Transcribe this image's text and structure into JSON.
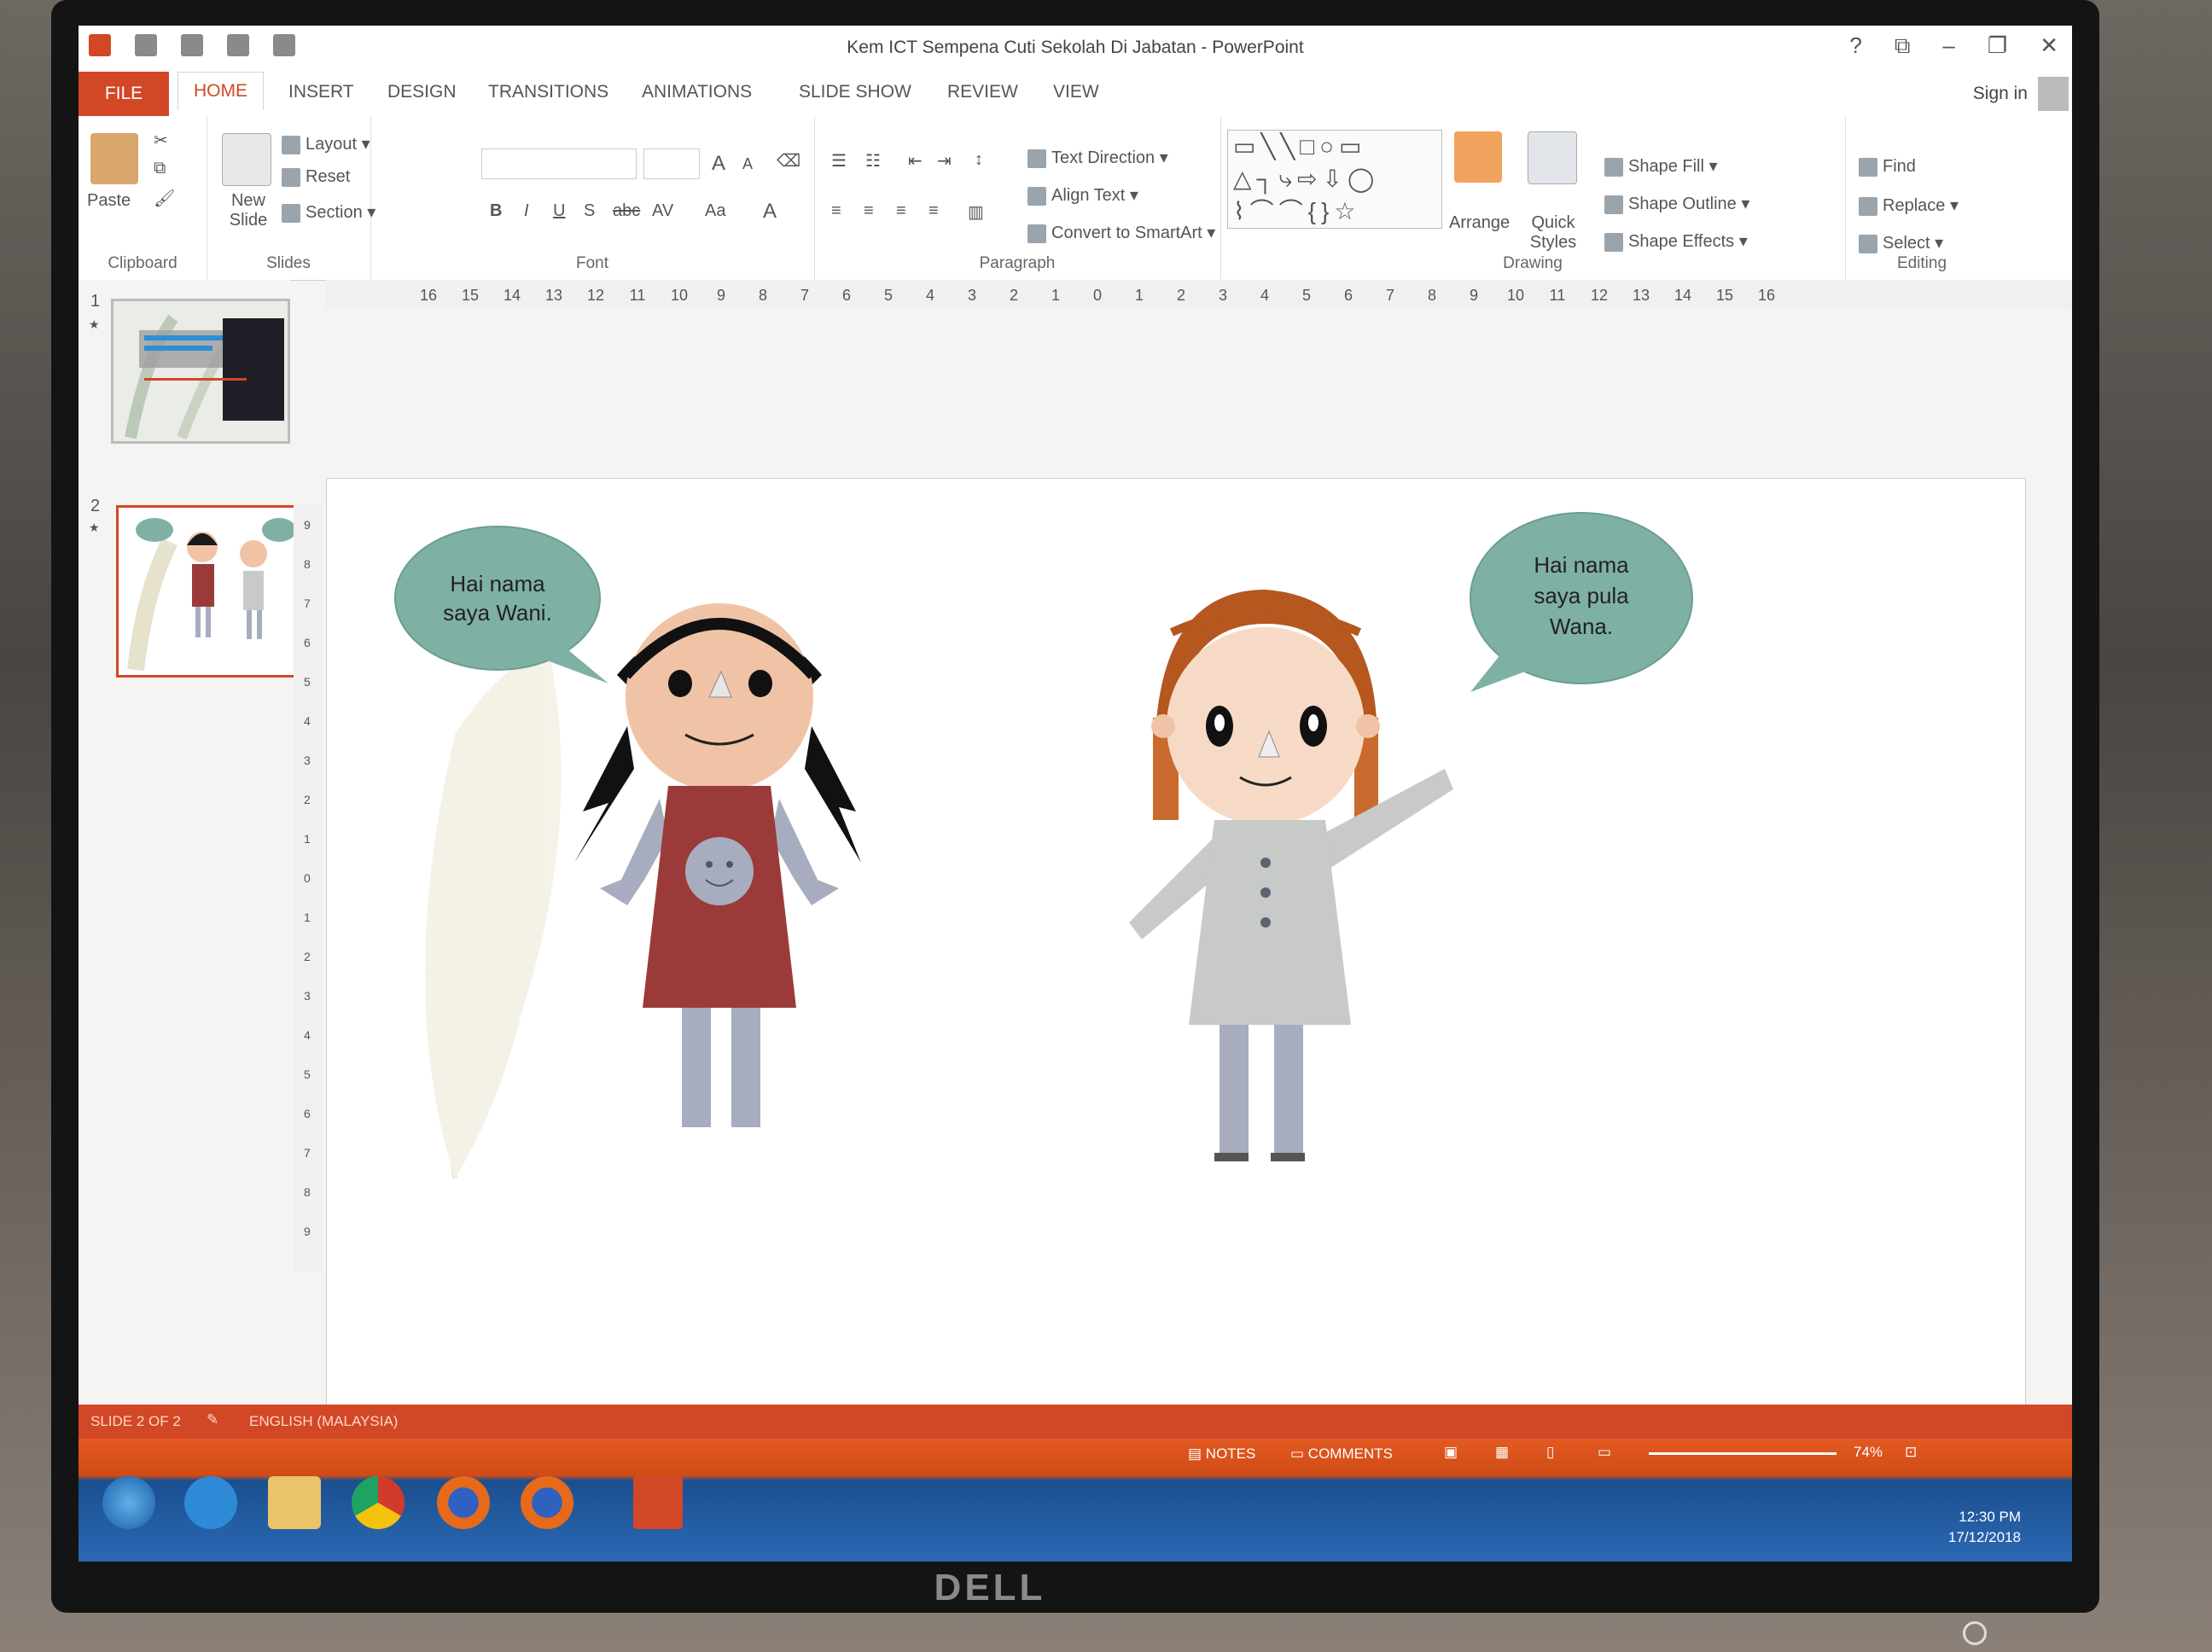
{
  "window": {
    "title": "Kem ICT Sempena Cuti Sekolah Di Jabatan - PowerPoint",
    "controls": [
      "?",
      "⧉",
      "–",
      "❐",
      "✕"
    ],
    "sign_in": "Sign in"
  },
  "tabs": [
    "FILE",
    "HOME",
    "INSERT",
    "DESIGN",
    "TRANSITIONS",
    "ANIMATIONS",
    "SLIDE SHOW",
    "REVIEW",
    "VIEW"
  ],
  "ribbon": {
    "clipboard": {
      "paste": "Paste",
      "label": "Clipboard"
    },
    "slides": {
      "new_slide": "New Slide",
      "layout": "Layout",
      "reset": "Reset",
      "section": "Section",
      "label": "Slides"
    },
    "font": {
      "label": "Font",
      "bold": "B",
      "italic": "I",
      "underline": "U",
      "shadow": "S",
      "strike": "abc",
      "spacing": "AV",
      "case": "Aa",
      "color": "A",
      "grow": "A",
      "shrink": "A"
    },
    "paragraph": {
      "text_direction": "Text Direction",
      "align_text": "Align Text",
      "smartart": "Convert to SmartArt",
      "label": "Paragraph"
    },
    "drawing": {
      "arrange": "Arrange",
      "quick_styles": "Quick Styles",
      "shape_fill": "Shape Fill",
      "shape_outline": "Shape Outline",
      "shape_effects": "Shape Effects",
      "label": "Drawing"
    },
    "editing": {
      "find": "Find",
      "replace": "Replace",
      "select": "Select",
      "label": "Editing"
    }
  },
  "ruler": {
    "horizontal": [
      "16",
      "15",
      "14",
      "13",
      "12",
      "11",
      "10",
      "9",
      "8",
      "7",
      "6",
      "5",
      "4",
      "3",
      "2",
      "1",
      "0",
      "1",
      "2",
      "3",
      "4",
      "5",
      "6",
      "7",
      "8",
      "9",
      "10",
      "11",
      "12",
      "13",
      "14",
      "15",
      "16"
    ],
    "vertical": [
      "9",
      "8",
      "7",
      "6",
      "5",
      "4",
      "3",
      "2",
      "1",
      "0",
      "1",
      "2",
      "3",
      "4",
      "5",
      "6",
      "7",
      "8",
      "9"
    ]
  },
  "thumbnails": [
    {
      "number": "1",
      "star": "★"
    },
    {
      "number": "2",
      "star": "★"
    }
  ],
  "slide": {
    "bubble_left": [
      "Hai nama",
      "saya Wani."
    ],
    "bubble_right": [
      "Hai nama",
      "saya pula",
      "Wana."
    ],
    "colors": {
      "bubble": "#7fb0a4",
      "dress": "#9b3b39",
      "skin": "#f1c3a6",
      "limbs": "#a7adbf"
    }
  },
  "status": {
    "slide": "SLIDE 2 OF 2",
    "language": "ENGLISH (MALAYSIA)",
    "notes": "NOTES",
    "comments": "COMMENTS",
    "zoom": "74%"
  },
  "tray": {
    "time": "12:30 PM",
    "date": "17/12/2018"
  },
  "taskbar_icons": [
    "start-orb-icon",
    "ie-icon",
    "explorer-icon",
    "chrome-icon",
    "firefox-icon",
    "firefox-icon",
    "powerpoint-icon"
  ],
  "monitor": {
    "brand": "DELL"
  }
}
